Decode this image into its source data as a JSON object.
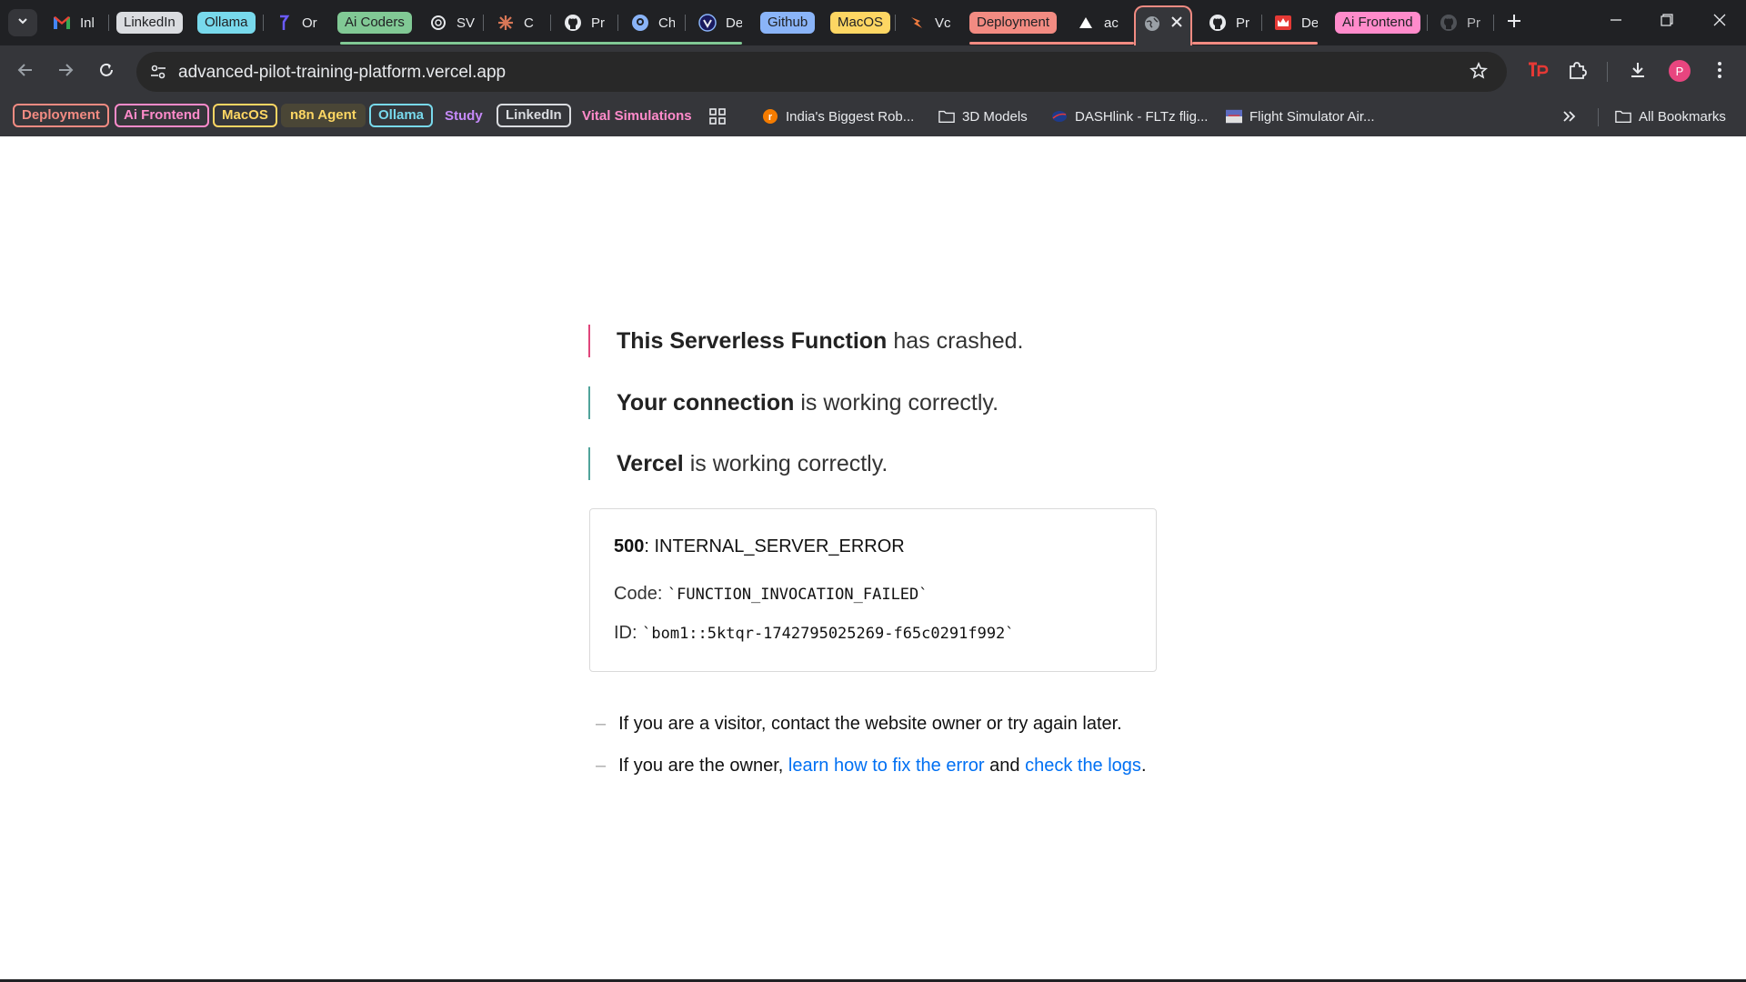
{
  "browser": {
    "tabs": [
      {
        "kind": "tab",
        "title": "Inl",
        "icon": "gmail-icon"
      },
      {
        "kind": "group",
        "label": "LinkedIn",
        "color": "#dadce0",
        "text": "#202124"
      },
      {
        "kind": "group",
        "label": "Ollama",
        "color": "#78d9ec",
        "text": "#202124"
      },
      {
        "kind": "tab",
        "title": "Or",
        "icon": "perplexity-icon"
      },
      {
        "kind": "group",
        "label": "Ai Coders",
        "color": "#81c995",
        "text": "#202124"
      },
      {
        "kind": "tab",
        "title": "SV",
        "icon": "openai-icon"
      },
      {
        "kind": "tab",
        "title": "C",
        "icon": "claude-icon"
      },
      {
        "kind": "tab",
        "title": "Pr",
        "icon": "github-icon"
      },
      {
        "kind": "tab",
        "title": "Ch",
        "icon": "chat-icon"
      },
      {
        "kind": "tab",
        "title": "De",
        "icon": "vercel-v0-icon"
      },
      {
        "kind": "group",
        "label": "Github",
        "color": "#8ab4f8",
        "text": "#202124"
      },
      {
        "kind": "group",
        "label": "MacOS",
        "color": "#fdd663",
        "text": "#202124"
      },
      {
        "kind": "tab",
        "title": "Vc",
        "icon": "bolt-icon"
      },
      {
        "kind": "group",
        "label": "Deployment",
        "color": "#f28b82",
        "text": "#202124"
      },
      {
        "kind": "tab",
        "title": "ac",
        "icon": "vercel-icon"
      },
      {
        "kind": "tab",
        "title": "",
        "icon": "globe-icon",
        "active": true
      },
      {
        "kind": "tab",
        "title": "Pr",
        "icon": "github-icon"
      },
      {
        "kind": "tab",
        "title": "De",
        "icon": "crown-icon"
      },
      {
        "kind": "group",
        "label": "Ai Frontend",
        "color": "#ff8bcb",
        "text": "#202124"
      },
      {
        "kind": "tab",
        "title": "Pr",
        "icon": "github-icon"
      }
    ],
    "address": "advanced-pilot-training-platform.vercel.app",
    "avatar_letter": "P",
    "bookmarks_chips": [
      {
        "label": "Deployment",
        "color": "#f28b82"
      },
      {
        "label": "Ai Frontend",
        "color": "#ff8bcb"
      },
      {
        "label": "MacOS",
        "color": "#fdd663"
      },
      {
        "label": "n8n Agent",
        "color": "#fdd663"
      },
      {
        "label": "Ollama",
        "color": "#78d9ec"
      },
      {
        "label": "Study",
        "color": "#c58af9"
      },
      {
        "label": "LinkedIn",
        "color": "#dadce0"
      },
      {
        "label": "Vital Simulations",
        "color": "#ff8bcb"
      }
    ],
    "bookmarks_links": [
      {
        "label": "India's Biggest Rob...",
        "icon": "robu-icon"
      },
      {
        "label": "3D Models",
        "icon": "folder-icon"
      },
      {
        "label": "DASHlink - FLTz flig...",
        "icon": "nasa-icon"
      },
      {
        "label": "Flight Simulator Air...",
        "icon": "flight-sim-icon"
      }
    ],
    "all_bookmarks": "All Bookmarks"
  },
  "page": {
    "status_lines": [
      {
        "bold": "This Serverless Function",
        "rest": "has crashed.",
        "color": "#e0457b"
      },
      {
        "bold": "Your connection",
        "rest": "is working correctly.",
        "color": "#50a39a"
      },
      {
        "bold": "Vercel",
        "rest": "is working correctly.",
        "color": "#50a39a"
      }
    ],
    "error": {
      "code_number": "500",
      "code_text": ": INTERNAL_SERVER_ERROR",
      "code_label": "Code:",
      "code_value": "`FUNCTION_INVOCATION_FAILED`",
      "id_label": "ID:",
      "id_value": "`bom1::5ktqr-1742795025269-f65c0291f992`"
    },
    "hints": {
      "dash": "–",
      "visitor": "If you are a visitor, contact the website owner or try again later.",
      "owner_prefix": "If you are the owner,",
      "owner_link1": "learn how to fix the error",
      "owner_mid": "and",
      "owner_link2": "check the logs",
      "owner_suffix": "."
    }
  }
}
